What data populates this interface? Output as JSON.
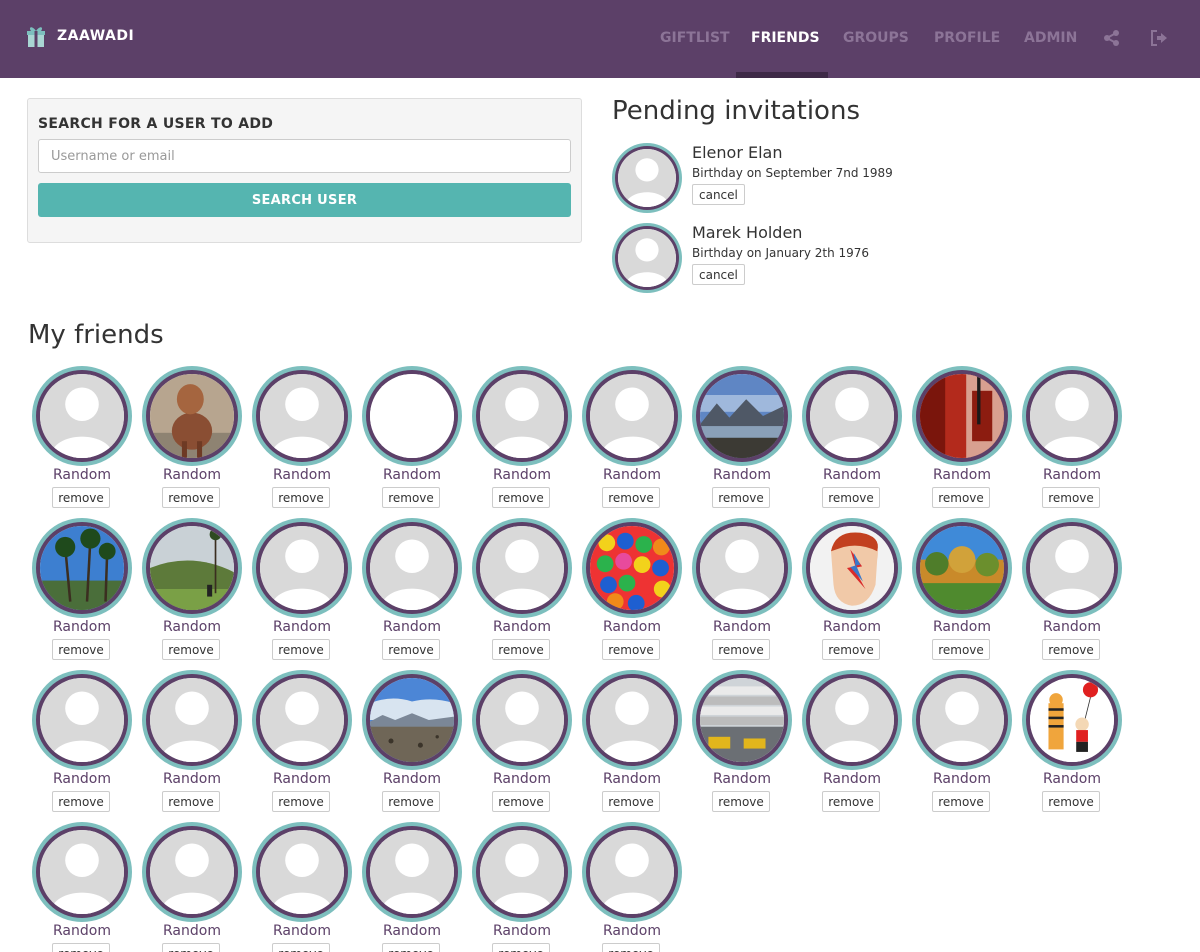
{
  "brand": {
    "name": "ZAAWADI",
    "icon": "gift-icon"
  },
  "nav": {
    "items": [
      {
        "label": "GIFTLIST",
        "active": false
      },
      {
        "label": "FRIENDS",
        "active": true
      },
      {
        "label": "GROUPS",
        "active": false
      },
      {
        "label": "PROFILE",
        "active": false
      },
      {
        "label": "ADMIN",
        "active": false
      }
    ],
    "icons": [
      "share-icon",
      "logout-icon"
    ]
  },
  "search": {
    "title": "SEARCH FOR A USER TO ADD",
    "placeholder": "Username or email",
    "value": "",
    "button_label": "SEARCH USER"
  },
  "pending": {
    "title": "Pending invitations",
    "items": [
      {
        "name": "Elenor Elan",
        "birthday": "Birthday on September 7nd 1989",
        "cancel_label": "cancel"
      },
      {
        "name": "Marek Holden",
        "birthday": "Birthday on January 2th 1976",
        "cancel_label": "cancel"
      }
    ]
  },
  "friends": {
    "title": "My friends",
    "remove_label": "remove",
    "items": [
      {
        "name": "Random",
        "avatar": "default"
      },
      {
        "name": "Random",
        "avatar": "llama-photo"
      },
      {
        "name": "Random",
        "avatar": "default"
      },
      {
        "name": "Random",
        "avatar": "blank"
      },
      {
        "name": "Random",
        "avatar": "default"
      },
      {
        "name": "Random",
        "avatar": "default"
      },
      {
        "name": "Random",
        "avatar": "mountain-lake-photo"
      },
      {
        "name": "Random",
        "avatar": "default"
      },
      {
        "name": "Random",
        "avatar": "red-clock-photo"
      },
      {
        "name": "Random",
        "avatar": "default"
      },
      {
        "name": "Random",
        "avatar": "palm-trees-photo"
      },
      {
        "name": "Random",
        "avatar": "valley-palms-photo"
      },
      {
        "name": "Random",
        "avatar": "default"
      },
      {
        "name": "Random",
        "avatar": "default"
      },
      {
        "name": "Random",
        "avatar": "default"
      },
      {
        "name": "Random",
        "avatar": "gumballs-photo"
      },
      {
        "name": "Random",
        "avatar": "default"
      },
      {
        "name": "Random",
        "avatar": "bowie-face-photo"
      },
      {
        "name": "Random",
        "avatar": "autumn-trees-photo"
      },
      {
        "name": "Random",
        "avatar": "default"
      },
      {
        "name": "Random",
        "avatar": "default"
      },
      {
        "name": "Random",
        "avatar": "default"
      },
      {
        "name": "Random",
        "avatar": "default"
      },
      {
        "name": "Random",
        "avatar": "desert-photo"
      },
      {
        "name": "Random",
        "avatar": "default"
      },
      {
        "name": "Random",
        "avatar": "default"
      },
      {
        "name": "Random",
        "avatar": "guggenheim-photo"
      },
      {
        "name": "Random",
        "avatar": "default"
      },
      {
        "name": "Random",
        "avatar": "default"
      },
      {
        "name": "Random",
        "avatar": "calvin-hobbes-drawing"
      },
      {
        "name": "Random",
        "avatar": "default"
      },
      {
        "name": "Random",
        "avatar": "default"
      },
      {
        "name": "Random",
        "avatar": "default"
      },
      {
        "name": "Random",
        "avatar": "default"
      },
      {
        "name": "Random",
        "avatar": "default"
      },
      {
        "name": "Random",
        "avatar": "default"
      }
    ]
  },
  "colors": {
    "nav_bg": "#5c4068",
    "nav_inactive": "#8c7497",
    "accent_teal": "#55b5b0",
    "ring_teal": "#7dbfbe",
    "ring_purple": "#5c4068",
    "friend_name": "#5c4068"
  }
}
